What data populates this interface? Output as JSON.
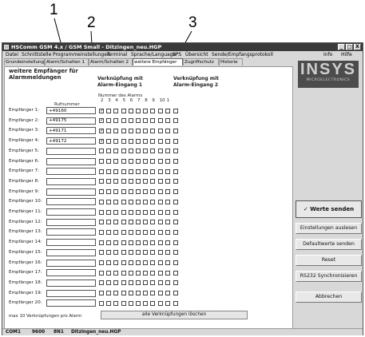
{
  "callouts": [
    "1",
    "2",
    "3"
  ],
  "window": {
    "title": "HSComm GSM 4.x / GSM Small - Ditzingen_neu.HGP",
    "buttons": [
      "_",
      "□",
      "X"
    ]
  },
  "menu": [
    "Datei",
    "Schnittstelle",
    "Programmeinstellungen",
    "Terminal",
    "Sprache/Language",
    "SPS",
    "Übersicht",
    "Sende/Empfangsprotokoll",
    "Info",
    "Hilfe"
  ],
  "tabs": [
    "Grundeinstellung",
    "Alarm/Schalten 1",
    "Alarm/Schalten 2",
    "weitere Empfänger",
    "Zugriffschutz",
    "Historie"
  ],
  "active_tab": 3,
  "panel": {
    "heading": "weitere Empfänger für Alarmmeldungen",
    "link1_heading": "Verknüpfung mit Alarm-Eingang 1",
    "link2_heading": "Verknüpfung mit Alarm-Eingang 2",
    "alarm_number_label": "Nummer des Alarms",
    "alarm_numbers": [
      "2",
      "3",
      "4",
      "5",
      "6",
      "7",
      "8",
      "9",
      "10",
      "1"
    ],
    "phone_column_label": "Rufnummer",
    "recipients": [
      {
        "label": "Empfänger 1:",
        "number": "+49160",
        "checked": [
          0
        ]
      },
      {
        "label": "Empfänger 2:",
        "number": "+49175",
        "checked": [
          0
        ]
      },
      {
        "label": "Empfänger 3:",
        "number": "+49171",
        "checked": [
          0
        ]
      },
      {
        "label": "Empfänger 4:",
        "number": "+49172",
        "checked": [
          0
        ]
      },
      {
        "label": "Empfänger 5:",
        "number": "",
        "checked": []
      },
      {
        "label": "Empfänger 6:",
        "number": "",
        "checked": []
      },
      {
        "label": "Empfänger 7:",
        "number": "",
        "checked": []
      },
      {
        "label": "Empfänger 8:",
        "number": "",
        "checked": []
      },
      {
        "label": "Empfänger 9:",
        "number": "",
        "checked": []
      },
      {
        "label": "Empfänger 10:",
        "number": "",
        "checked": []
      },
      {
        "label": "Empfänger 11:",
        "number": "",
        "checked": []
      },
      {
        "label": "Empfänger 12:",
        "number": "",
        "checked": []
      },
      {
        "label": "Empfänger 13:",
        "number": "",
        "checked": []
      },
      {
        "label": "Empfänger 14:",
        "number": "",
        "checked": []
      },
      {
        "label": "Empfänger 15:",
        "number": "",
        "checked": []
      },
      {
        "label": "Empfänger 16:",
        "number": "",
        "checked": []
      },
      {
        "label": "Empfänger 17:",
        "number": "",
        "checked": []
      },
      {
        "label": "Empfänger 18:",
        "number": "",
        "checked": []
      },
      {
        "label": "Empfänger 19:",
        "number": "",
        "checked": []
      },
      {
        "label": "Empfänger 20:",
        "number": "",
        "checked": []
      }
    ],
    "max_links_note": "max 10 Verknüpfungen pro Alarm",
    "clear_button": "alle Verknüpfungen löschen"
  },
  "sidebar": {
    "logo_text": "INSYS",
    "logo_subtext": "MICROELECTRONICS",
    "send_values": "✓ Werte senden",
    "read_settings": "Einstellungen auslesen",
    "send_defaults": "Defaultwerte senden",
    "reset": "Reset",
    "rs232_sync": "RS232 Synchronisieren",
    "cancel": "Abbrechen"
  },
  "status": {
    "port": "COM1",
    "baud": "9600",
    "format": "8N1",
    "file": "Ditzingen_neu.HGP"
  },
  "icons": {
    "checkmark": "checkmark-icon",
    "app": "app-icon"
  }
}
